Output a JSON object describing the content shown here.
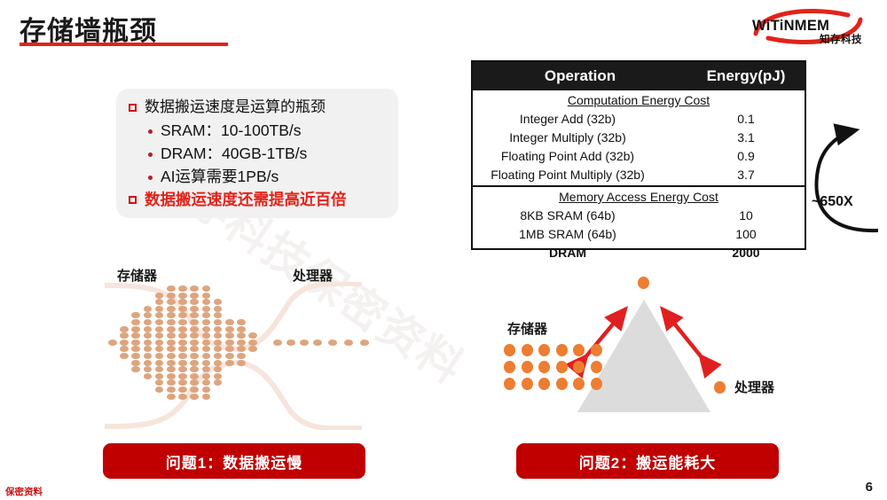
{
  "slide": {
    "title": "存储墙瓶颈",
    "page_number": "6",
    "footer_note": "保密资料",
    "watermark": "知存科技保密资料",
    "accent_color": "#e2231a",
    "pill_color": "#c00000"
  },
  "logo": {
    "wordmark": "WiTiNMEM",
    "subtext": "知存科技",
    "swoosh_color": "#e2231a"
  },
  "bullets": [
    {
      "level": 1,
      "marker": "square",
      "text": "数据搬运速度是运算的瓶颈",
      "emphasis": false
    },
    {
      "level": 2,
      "marker": "dot",
      "text": "SRAM：10-100TB/s",
      "emphasis": false
    },
    {
      "level": 2,
      "marker": "dot",
      "text": "DRAM：40GB-1TB/s",
      "emphasis": false
    },
    {
      "level": 2,
      "marker": "dot",
      "text": "AI运算需要1PB/s",
      "emphasis": false
    },
    {
      "level": 1,
      "marker": "square",
      "text": "数据搬运速度还需提高近百倍",
      "emphasis": true
    }
  ],
  "energy_table": {
    "headers": [
      "Operation",
      "Energy(pJ)"
    ],
    "sections": [
      {
        "title": "Computation Energy Cost",
        "rows": [
          {
            "op": "Integer Add (32b)",
            "energy": "0.1",
            "bold": false
          },
          {
            "op": "Integer Multiply (32b)",
            "energy": "3.1",
            "bold": false
          },
          {
            "op": "Floating Point Add (32b)",
            "energy": "0.9",
            "bold": false
          },
          {
            "op": "Floating Point Multiply (32b)",
            "energy": "3.7",
            "bold": false
          }
        ]
      },
      {
        "title": "Memory Access Energy Cost",
        "rows": [
          {
            "op": "8KB SRAM (64b)",
            "energy": "10",
            "bold": false
          },
          {
            "op": "1MB SRAM (64b)",
            "energy": "100",
            "bold": false
          },
          {
            "op": "DRAM",
            "energy": "2000",
            "bold": true
          }
        ]
      }
    ],
    "annotation": "~650X"
  },
  "diagram_left": {
    "label_memory": "存储器",
    "label_processor": "处理器",
    "dot_color": "#dda57e"
  },
  "diagram_right": {
    "label_memory": "存储器",
    "label_processor": "处理器",
    "dot_color": "#ED7D31",
    "mountain_color": "#dcdcdc",
    "arrow_color": "#e02020"
  },
  "pills": [
    {
      "label": "问题1：数据搬运慢"
    },
    {
      "label": "问题2：搬运能耗大"
    }
  ]
}
